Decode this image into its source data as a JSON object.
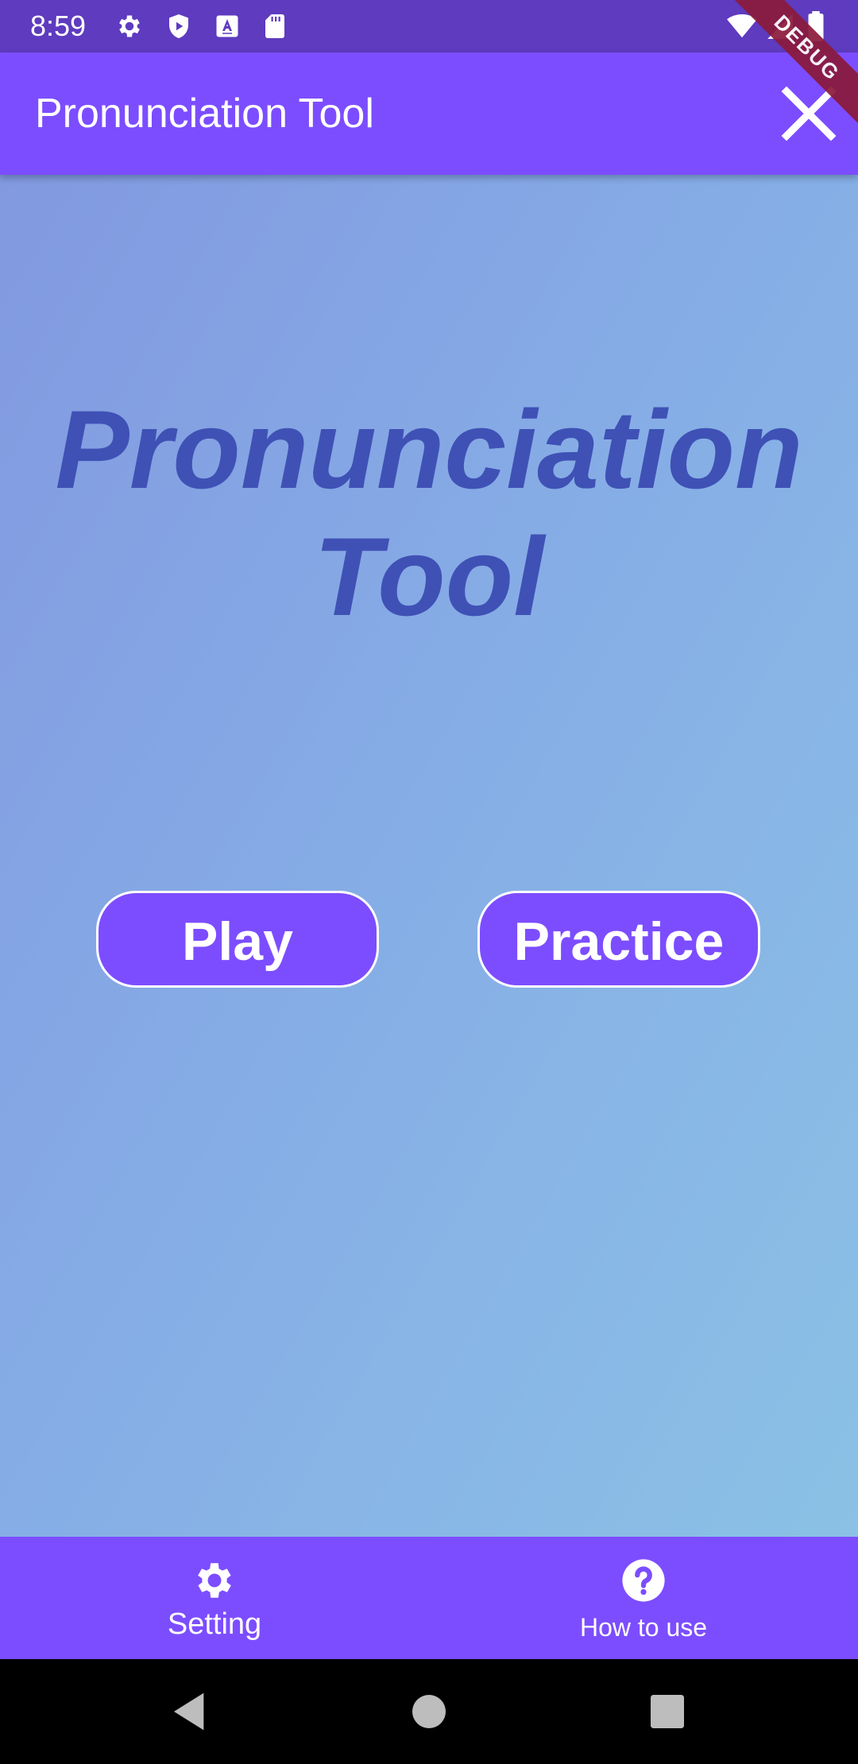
{
  "status_bar": {
    "time": "8:59",
    "icons": [
      "gear-icon",
      "shield-play-icon",
      "font-icon",
      "sd-card-icon",
      "wifi-icon",
      "signal-icon",
      "battery-icon"
    ]
  },
  "app_bar": {
    "title": "Pronunciation Tool",
    "close_icon": "close-icon",
    "debug_label": "DEBUG"
  },
  "main": {
    "hero_title_line1": "Pronunciation",
    "hero_title_line2": "Tool",
    "play_label": "Play",
    "practice_label": "Practice"
  },
  "bottom_nav": {
    "items": [
      {
        "label": "Setting",
        "icon": "gear-icon"
      },
      {
        "label": "How to use",
        "icon": "help-circle-icon"
      }
    ]
  },
  "system_nav": {
    "icons": [
      "back-icon",
      "home-icon",
      "recents-icon"
    ]
  },
  "colors": {
    "status_bar": "#5e3bbf",
    "primary": "#7c4dff",
    "title_text": "#3f51b5",
    "debug_banner": "#8b1a3a"
  }
}
